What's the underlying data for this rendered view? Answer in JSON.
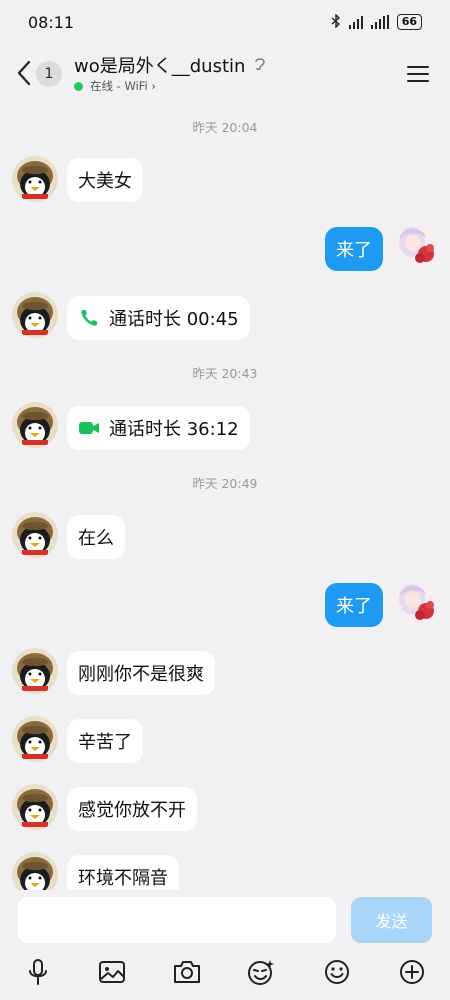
{
  "status_bar": {
    "time": "08:11",
    "battery": "66"
  },
  "header": {
    "back_count": "1",
    "contact_name": "wo是局外く__dustin",
    "online_status": "在线 - WiFi ›"
  },
  "messages": [
    {
      "type": "time",
      "text": "昨天 20:04"
    },
    {
      "type": "in",
      "text": "大美女"
    },
    {
      "type": "out",
      "text": "来了"
    },
    {
      "type": "in-call",
      "text": "通话时长 00:45",
      "icon": "phone-icon"
    },
    {
      "type": "time",
      "text": "昨天 20:43"
    },
    {
      "type": "in-call",
      "text": "通话时长 36:12",
      "icon": "video-icon"
    },
    {
      "type": "time",
      "text": "昨天 20:49"
    },
    {
      "type": "in",
      "text": "在么"
    },
    {
      "type": "out",
      "text": "来了"
    },
    {
      "type": "in",
      "text": "刚刚你不是很爽"
    },
    {
      "type": "in",
      "text": "辛苦了"
    },
    {
      "type": "in",
      "text": "感觉你放不开"
    },
    {
      "type": "in",
      "text": "环境不隔音"
    }
  ],
  "input": {
    "placeholder": "",
    "send_label": "发送"
  },
  "toolbar": [
    "microphone-icon",
    "image-icon",
    "camera-icon",
    "sticker-icon",
    "emoji-icon",
    "plus-icon"
  ],
  "colors": {
    "accent": "#1e9bf0",
    "send_disabled": "#a8d5f8",
    "online": "#2ac464",
    "call_green": "#17c25b"
  }
}
